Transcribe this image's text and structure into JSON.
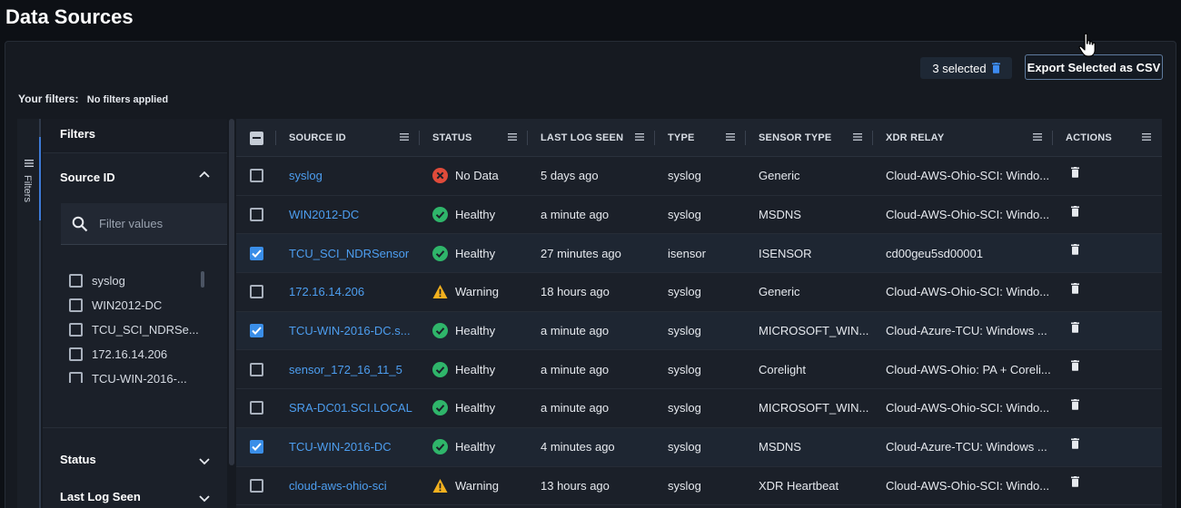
{
  "page": {
    "title": "Data Sources"
  },
  "toolbar": {
    "selected_text": "3 selected",
    "export_label": "Export Selected as CSV"
  },
  "filters_summary": {
    "label": "Your filters:",
    "value": "No filters applied"
  },
  "rail": {
    "label": "Filters"
  },
  "filters_panel": {
    "header": "Filters",
    "source_id": {
      "title": "Source ID",
      "search_placeholder": "Filter values",
      "options": [
        "syslog",
        "WIN2012-DC",
        "TCU_SCI_NDRSe...",
        "172.16.14.206",
        "TCU-WIN-2016-..."
      ]
    },
    "status_title": "Status",
    "last_log_title": "Last Log Seen"
  },
  "table": {
    "columns": [
      "SOURCE ID",
      "STATUS",
      "LAST LOG SEEN",
      "TYPE",
      "SENSOR TYPE",
      "XDR RELAY",
      "ACTIONS"
    ],
    "status_colors": {
      "No Data": "#e04b3a",
      "Healthy": "#2fb56a",
      "Warning": "#f2b01e"
    },
    "rows": [
      {
        "checked": false,
        "source_id": "syslog",
        "status": "No Data",
        "last_log": "5 days ago",
        "type": "syslog",
        "sensor_type": "Generic",
        "relay": "Cloud-AWS-Ohio-SCI: Windo..."
      },
      {
        "checked": false,
        "source_id": "WIN2012-DC",
        "status": "Healthy",
        "last_log": "a minute ago",
        "type": "syslog",
        "sensor_type": "MSDNS",
        "relay": "Cloud-AWS-Ohio-SCI: Windo..."
      },
      {
        "checked": true,
        "source_id": "TCU_SCI_NDRSensor",
        "status": "Healthy",
        "last_log": "27 minutes ago",
        "type": "isensor",
        "sensor_type": "ISENSOR",
        "relay": "cd00geu5sd00001"
      },
      {
        "checked": false,
        "source_id": "172.16.14.206",
        "status": "Warning",
        "last_log": "18 hours ago",
        "type": "syslog",
        "sensor_type": "Generic",
        "relay": "Cloud-AWS-Ohio-SCI: Windo..."
      },
      {
        "checked": true,
        "source_id": "TCU-WIN-2016-DC.s...",
        "status": "Healthy",
        "last_log": "a minute ago",
        "type": "syslog",
        "sensor_type": "MICROSOFT_WIN...",
        "relay": "Cloud-Azure-TCU: Windows ..."
      },
      {
        "checked": false,
        "source_id": "sensor_172_16_11_5",
        "status": "Healthy",
        "last_log": "a minute ago",
        "type": "syslog",
        "sensor_type": "Corelight",
        "relay": "Cloud-AWS-Ohio: PA + Coreli..."
      },
      {
        "checked": false,
        "source_id": "SRA-DC01.SCI.LOCAL",
        "status": "Healthy",
        "last_log": "a minute ago",
        "type": "syslog",
        "sensor_type": "MICROSOFT_WIN...",
        "relay": "Cloud-AWS-Ohio-SCI: Windo..."
      },
      {
        "checked": true,
        "source_id": "TCU-WIN-2016-DC",
        "status": "Healthy",
        "last_log": "4 minutes ago",
        "type": "syslog",
        "sensor_type": "MSDNS",
        "relay": "Cloud-Azure-TCU: Windows ..."
      },
      {
        "checked": false,
        "source_id": "cloud-aws-ohio-sci",
        "status": "Warning",
        "last_log": "13 hours ago",
        "type": "syslog",
        "sensor_type": "XDR Heartbeat",
        "relay": "Cloud-AWS-Ohio-SCI: Windo..."
      }
    ]
  }
}
